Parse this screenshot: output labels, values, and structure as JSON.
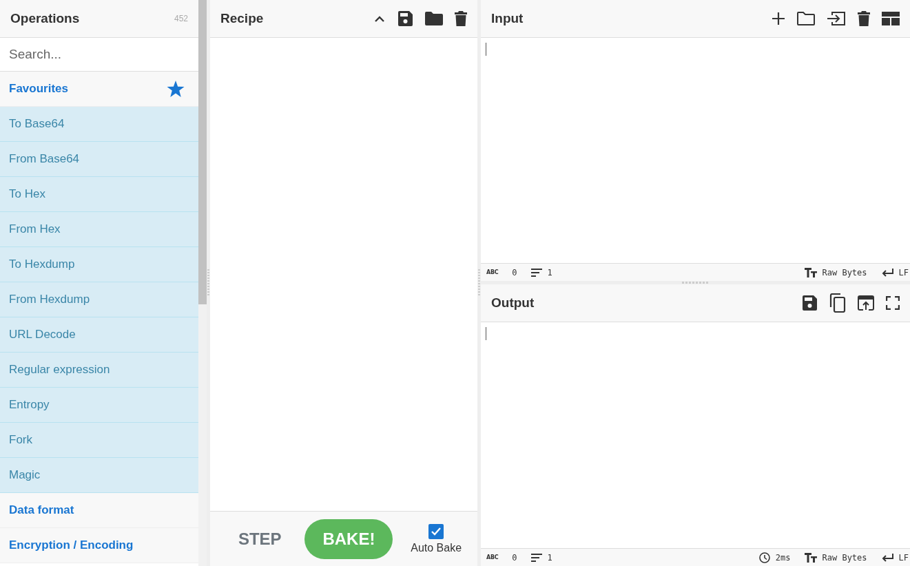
{
  "operations": {
    "title": "Operations",
    "count": "452",
    "search": {
      "placeholder": "Search..."
    },
    "categories": [
      {
        "name": "Favourites",
        "expanded": true,
        "items": [
          "To Base64",
          "From Base64",
          "To Hex",
          "From Hex",
          "To Hexdump",
          "From Hexdump",
          "URL Decode",
          "Regular expression",
          "Entropy",
          "Fork",
          "Magic"
        ]
      },
      {
        "name": "Data format",
        "expanded": false
      },
      {
        "name": "Encryption / Encoding",
        "expanded": false
      }
    ]
  },
  "recipe": {
    "title": "Recipe",
    "step": "STEP",
    "bake": "BAKE!",
    "auto_bake": {
      "label": "Auto Bake",
      "checked": true
    }
  },
  "input": {
    "title": "Input",
    "status": {
      "chars_label": "ABC",
      "chars": "0",
      "lines": "1",
      "encoding": "Raw Bytes",
      "eol": "LF"
    }
  },
  "output": {
    "title": "Output",
    "status": {
      "chars_label": "ABC",
      "chars": "0",
      "lines": "1",
      "time": "2ms",
      "encoding": "Raw Bytes",
      "eol": "LF"
    }
  }
}
